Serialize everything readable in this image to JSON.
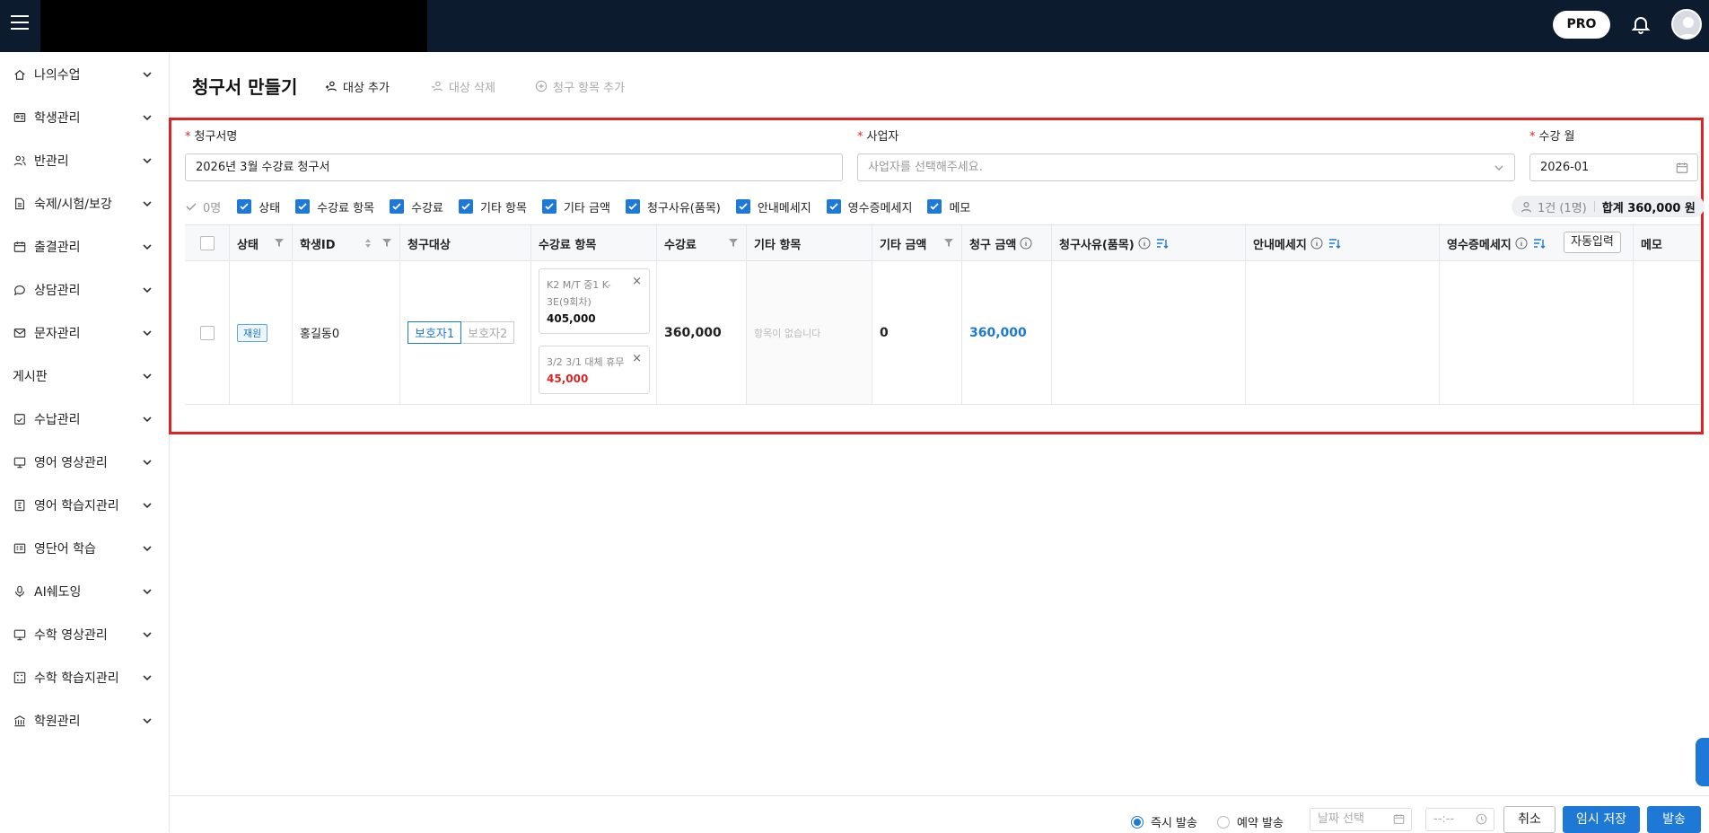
{
  "topbar": {
    "badge": "PRO"
  },
  "sidebar": {
    "items": [
      {
        "label": "나의수업",
        "icon": "home-icon"
      },
      {
        "label": "학생관리",
        "icon": "id-card-icon"
      },
      {
        "label": "반관리",
        "icon": "users-icon"
      },
      {
        "label": "숙제/시험/보강",
        "icon": "document-icon"
      },
      {
        "label": "출결관리",
        "icon": "calendar-icon"
      },
      {
        "label": "상담관리",
        "icon": "chat-icon"
      },
      {
        "label": "문자관리",
        "icon": "mail-icon"
      },
      {
        "label": "게시판",
        "icon": ""
      },
      {
        "label": "수납관리",
        "icon": "receipt-icon"
      },
      {
        "label": "영어 영상관리",
        "icon": "monitor-icon"
      },
      {
        "label": "영어 학습지관리",
        "icon": "worksheet-icon"
      },
      {
        "label": "영단어 학습",
        "icon": "flashcard-icon"
      },
      {
        "label": "AI쉐도잉",
        "icon": "microphone-icon"
      },
      {
        "label": "수학 영상관리",
        "icon": "monitor-icon"
      },
      {
        "label": "수학 학습지관리",
        "icon": "grid-icon"
      },
      {
        "label": "학원관리",
        "icon": "building-icon"
      }
    ]
  },
  "header": {
    "title": "청구서 만들기",
    "add_target": "대상 추가",
    "delete_target": "대상 삭제",
    "add_item": "청구 항목 추가"
  },
  "form": {
    "bill_name_label": "청구서명",
    "bill_name_value": "2026년 3월 수강료 청구서",
    "business_label": "사업자",
    "business_placeholder": "사업자를 선택해주세요.",
    "month_label": "수강 월",
    "month_value": "2026-01"
  },
  "toggles": {
    "selected_count": "0명",
    "options": [
      "상태",
      "수강료 항목",
      "수강료",
      "기타 항목",
      "기타 금액",
      "청구사유(품목)",
      "안내메세지",
      "영수증메세지",
      "메모"
    ]
  },
  "summary": {
    "persons": "1건 (1명)",
    "total": "합계 360,000 원"
  },
  "table": {
    "columns": {
      "status": "상태",
      "student_id": "학생ID",
      "target": "청구대상",
      "fee_items": "수강료 항목",
      "fee": "수강료",
      "other_items": "기타 항목",
      "other_amount": "기타 금액",
      "bill_amount": "청구 금액",
      "reason": "청구사유(품목)",
      "notice": "안내메세지",
      "receipt": "영수증메세지",
      "memo": "메모"
    },
    "auto_input": "자동입력",
    "row": {
      "status": "재원",
      "student": "홍길동0",
      "guardian1": "보호자1",
      "guardian2": "보호자2",
      "fee_items": [
        {
          "name": "K2 M/T 중1 K-3E(9회차)",
          "amount": "405,000"
        },
        {
          "name": "3/2 3/1 대체 휴무",
          "amount": "45,000"
        }
      ],
      "fee": "360,000",
      "other_items": "항목이 없습니다",
      "other_amount": "0",
      "bill_amount": "360,000"
    }
  },
  "footer": {
    "send_now": "즉시 발송",
    "send_reserve": "예약 발송",
    "date_placeholder": "날짜 선택",
    "time_placeholder": "--:--",
    "cancel": "취소",
    "temp_save": "임시 저장",
    "send": "발송"
  },
  "colors": {
    "primary": "#1e78d6",
    "highlight_frame": "#d92525",
    "topbar": "#0d1b2e"
  }
}
